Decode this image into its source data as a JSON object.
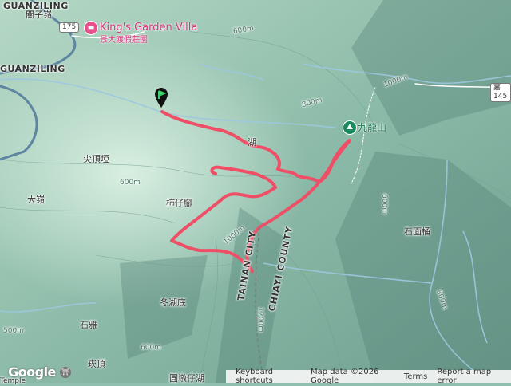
{
  "map": {
    "colors": {
      "terrain_light": "#cfe8d8",
      "terrain_mid": "#8fbfae",
      "terrain_dark": "#5d8f82",
      "river": "#9cc8e0",
      "road": "#6a8fa8",
      "route": "#ee4f66",
      "hotel": "#e8508c",
      "peak": "#1a8a5c"
    },
    "places": {
      "guanziling": "GUANZILING",
      "guanziling_zh": "關子嶺",
      "guanziling_lower": "GUANZILING",
      "jianding": "尖頂埡",
      "daling": "大嶺",
      "shizijiao": "柿仔腳",
      "donghudi": "冬湖底",
      "shiya": "石雅",
      "shimiantong": "石面桶",
      "kanding": "崁頂",
      "yuandunzaihu": "圓墩仔湖",
      "templepartial": "Temple",
      "hu": "湖"
    },
    "roads": {
      "r175": "175",
      "r145": "嘉145"
    },
    "hotel": {
      "name": "King's Garden Villa",
      "name_zh": "景大渡假莊園",
      "icon": "bed-icon"
    },
    "peak": {
      "name": "九龍山",
      "icon": "hiker-icon"
    },
    "contours": {
      "c600a": "600m",
      "c600b": "600m",
      "c800": "800m",
      "c1000a": "1000m",
      "c1000b": "1000m",
      "c500": "500m",
      "c800b": "800m",
      "c600c": "600m",
      "c600d": "600m",
      "c1200": "1200m"
    },
    "boundary": {
      "tainan": "TAINAN CITY",
      "chiayi": "CHIAYI COUNTY"
    }
  },
  "footer": {
    "logo": "Google",
    "keyboard": "Keyboard shortcuts",
    "mapdata": "Map data ©2026 Google",
    "terms": "Terms",
    "report": "Report a map error"
  }
}
